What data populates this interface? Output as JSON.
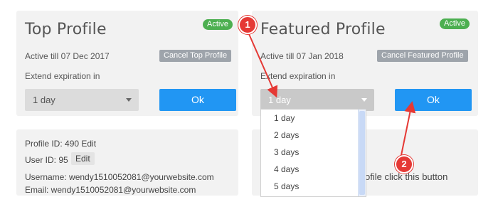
{
  "top_profile": {
    "title": "Top Profile",
    "status_badge": "Active",
    "active_till": "Active till 07 Dec 2017",
    "cancel_label": "Cancel Top Profile",
    "extend_label": "Extend expiration in",
    "duration_value": "1 day",
    "ok_label": "Ok"
  },
  "featured_profile": {
    "title": "Featured Profile",
    "status_badge": "Active",
    "active_till": "Active till 07 Jan 2018",
    "cancel_label": "Cancel Featured Profile",
    "extend_label": "Extend expiration in",
    "duration_value": "1 day",
    "ok_label": "Ok",
    "dropdown_options": [
      "1 day",
      "2 days",
      "3 days",
      "4 days",
      "5 days"
    ]
  },
  "profile_info": {
    "profile_id": "Profile ID: 490 Edit",
    "user_id": "User ID: 95",
    "user_edit": "Edit",
    "username": "Username: wendy1510052081@yourwebsite.com",
    "email": "Email: wendy1510052081@yourwebsite.com"
  },
  "obscured_text": "ofile click this button",
  "markers": [
    "1",
    "2"
  ],
  "colors": {
    "accent_blue": "#2196f3",
    "active_green": "#4caf50",
    "annotation_red": "#e53935",
    "card_bg": "#f2f2f2"
  }
}
